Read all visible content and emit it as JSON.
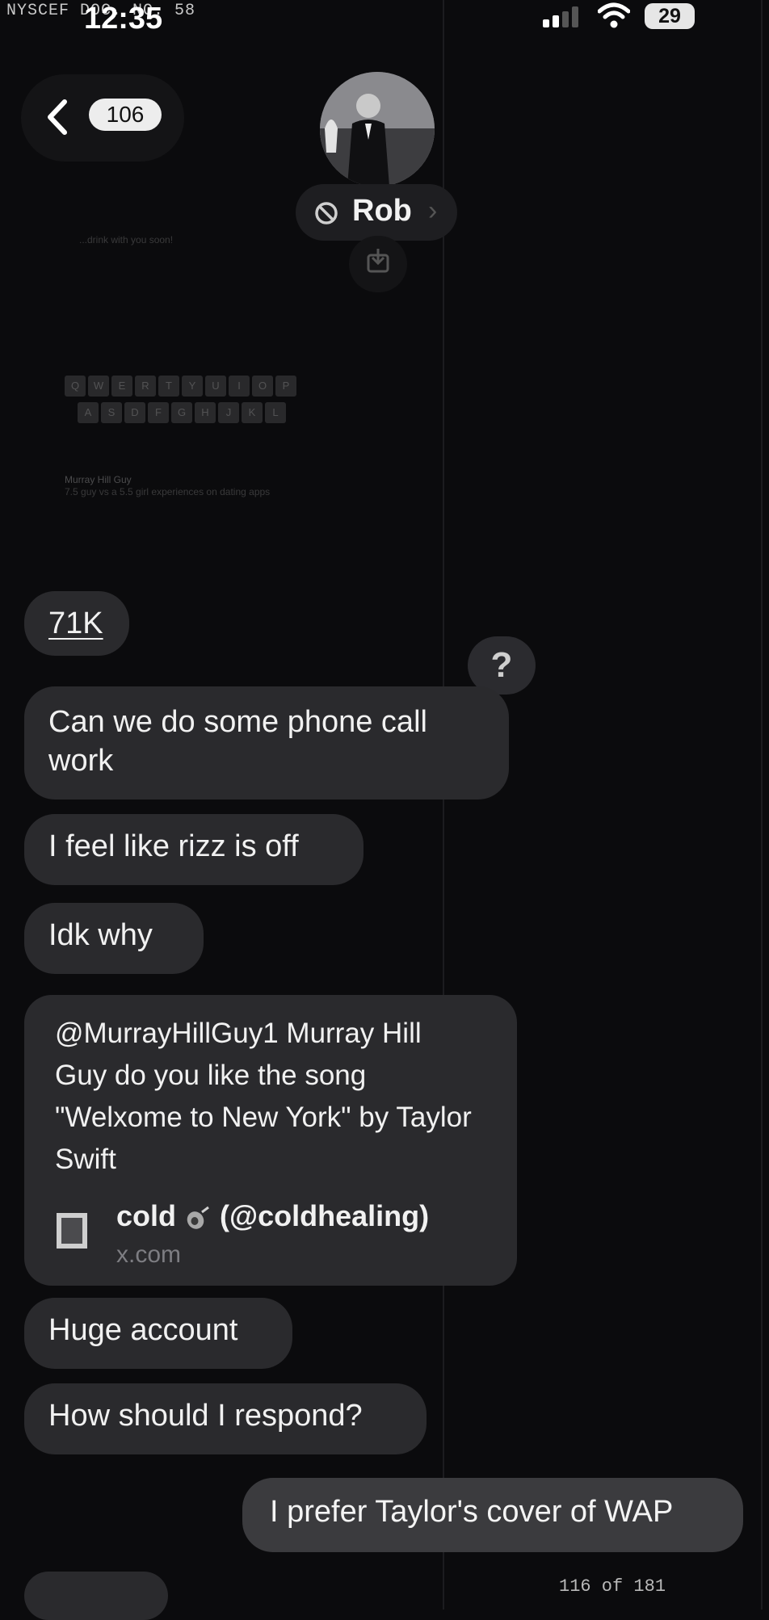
{
  "header_stamp": "NYSCEF DOC. NO. 58",
  "status_bar": {
    "time": "12:35",
    "battery": "29"
  },
  "nav": {
    "unread_count": "106"
  },
  "contact": {
    "name": "Rob"
  },
  "background_preview": {
    "desc_lines": [
      "...drink with you soon!"
    ],
    "keyboard_row1": [
      "Q",
      "W",
      "E",
      "R",
      "T",
      "Y",
      "U",
      "I",
      "O",
      "P"
    ],
    "keyboard_row2": [
      "A",
      "S",
      "D",
      "F",
      "G",
      "H",
      "J",
      "K",
      "L"
    ],
    "post_author": "Murray Hill Guy",
    "post_text": "7.5 guy vs a 5.5 girl experiences on dating apps"
  },
  "messages": [
    {
      "id": "m1",
      "direction": "in",
      "text": "71K"
    },
    {
      "id": "m2",
      "direction": "in",
      "text": "Can we do some phone call work"
    },
    {
      "id": "m3",
      "direction": "in",
      "text": "I feel like rizz is off"
    },
    {
      "id": "m4",
      "direction": "in",
      "text": "Idk why"
    },
    {
      "id": "m5",
      "direction": "in",
      "text": "@MurrayHillGuy1 Murray Hill Guy do you like the song \"Welxome to New York\" by Taylor Swift",
      "link": {
        "title_name": "cold",
        "title_handle": "(@coldhealing)",
        "domain": "x.com"
      }
    },
    {
      "id": "m6",
      "direction": "in",
      "text": "Huge account"
    },
    {
      "id": "m7",
      "direction": "in",
      "text": "How should I respond?"
    },
    {
      "id": "m8",
      "direction": "out",
      "text": "I prefer Taylor's cover of WAP"
    }
  ],
  "reaction": {
    "symbol": "?"
  },
  "page_stamp": "116 of 181"
}
